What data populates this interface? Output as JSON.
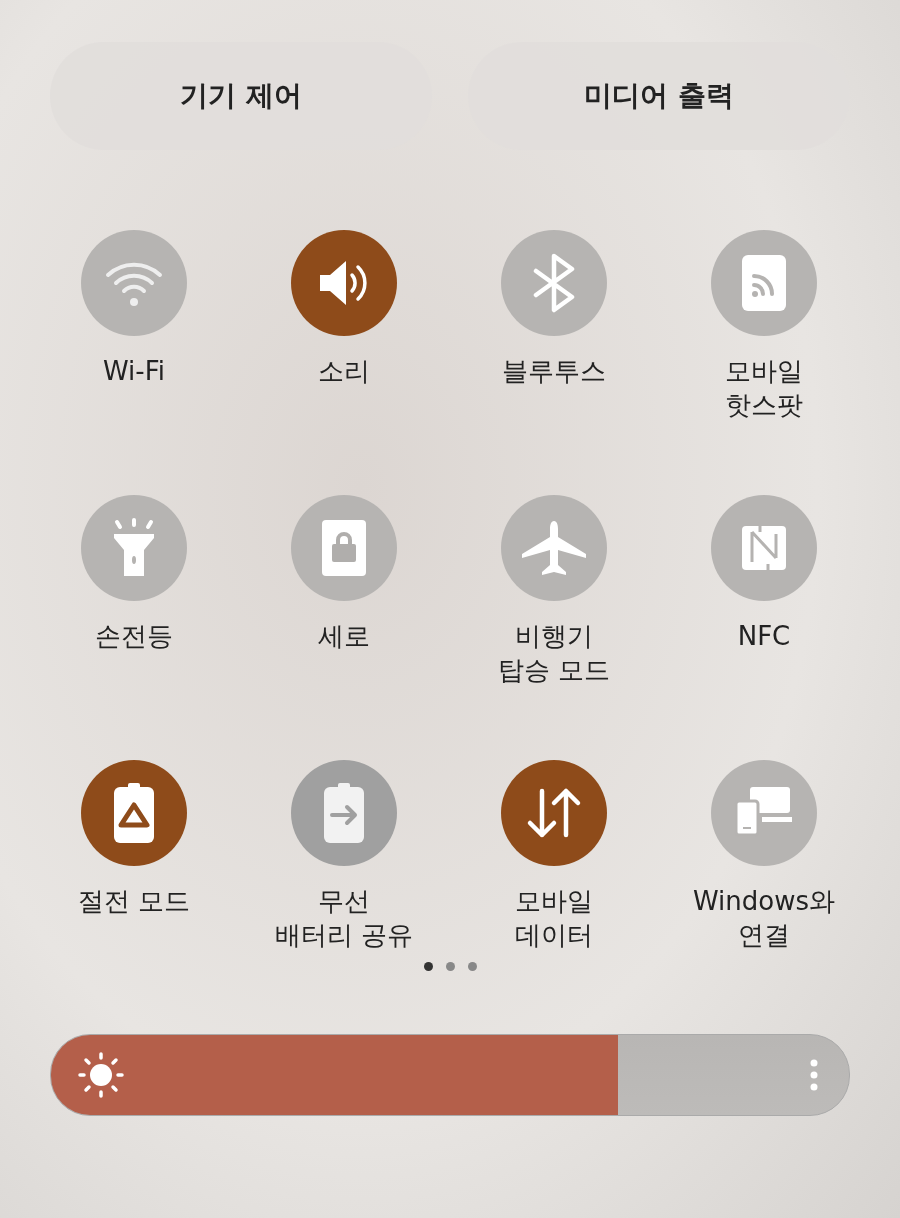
{
  "top_buttons": [
    "기기 제어",
    "미디어 출력"
  ],
  "tiles": [
    {
      "label": "Wi-Fi",
      "on": false
    },
    {
      "label": "소리",
      "on": true
    },
    {
      "label": "블루투스",
      "on": false
    },
    {
      "label": "모바일\n핫스팟",
      "on": false
    },
    {
      "label": "손전등",
      "on": false
    },
    {
      "label": "세로",
      "on": false
    },
    {
      "label": "비행기\n탑승 모드",
      "on": false
    },
    {
      "label": "NFC",
      "on": false
    },
    {
      "label": "절전 모드",
      "on": true
    },
    {
      "label": "무선\n배터리 공유",
      "on": false
    },
    {
      "label": "모바일\n데이터",
      "on": true
    },
    {
      "label": "Windows와\n연결",
      "on": false
    }
  ],
  "page_dots": [
    {
      "selected": true
    },
    {
      "selected": false
    },
    {
      "selected": false
    }
  ],
  "brightness": {
    "level": 0.71
  }
}
